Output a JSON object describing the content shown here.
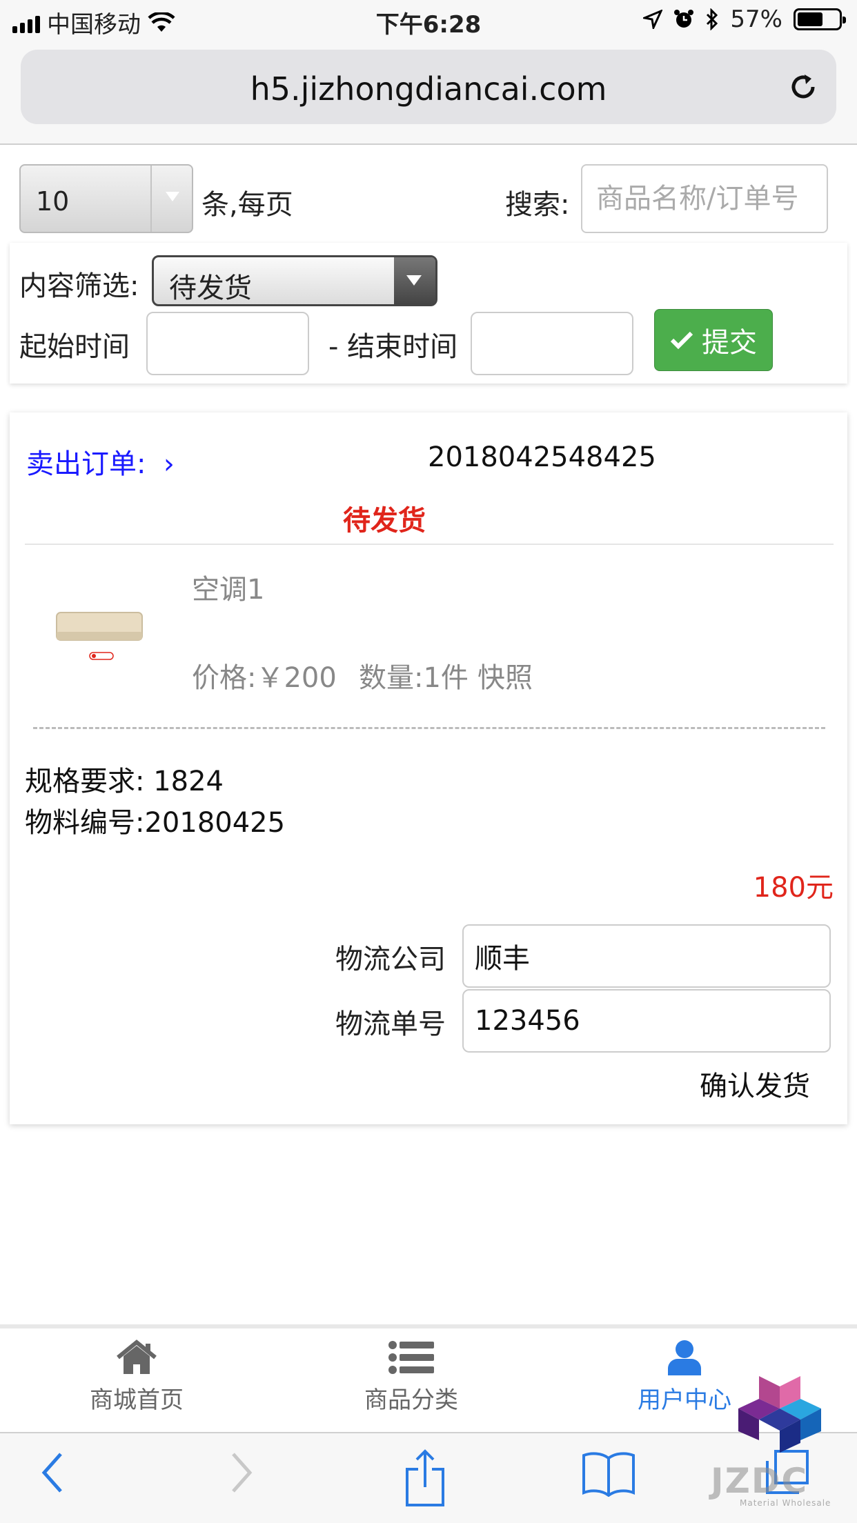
{
  "status_bar": {
    "carrier": "中国移动",
    "time": "下午6:28",
    "battery": "57%"
  },
  "browser": {
    "url": "h5.jizhongdiancai.com"
  },
  "filters": {
    "page_size": "10",
    "page_size_suffix": "条,每页",
    "search_label": "搜索:",
    "search_placeholder": "商品名称/订单号",
    "filter_label": "内容筛选:",
    "filter_value": "待发货",
    "start_label": "起始时间",
    "end_label": "- 结束时间",
    "submit_label": "提交"
  },
  "order": {
    "link_label": "卖出订单:",
    "order_number": "2018042548425",
    "status": "待发货",
    "product_name": "空调1",
    "price": "价格:￥200",
    "quantity": "数量:1件",
    "snapshot": "快照",
    "spec": "规格要求: 1824",
    "material_no": "物料编号:20180425",
    "amount": "180元",
    "logistics_company_label": "物流公司",
    "logistics_company_value": "顺丰",
    "logistics_no_label": "物流单号",
    "logistics_no_value": "123456",
    "confirm_label": "确认发货"
  },
  "tabs": [
    {
      "label": "商城首页",
      "icon": "home-icon"
    },
    {
      "label": "商品分类",
      "icon": "list-icon"
    },
    {
      "label": "用户中心",
      "icon": "user-icon",
      "active": true
    }
  ],
  "watermark": {
    "text": "JZDC",
    "sub": "Material Wholesale"
  },
  "colors": {
    "link": "#1a1aff",
    "status_red": "#e0251b",
    "submit_green": "#4cae4c",
    "tab_active": "#2a7be3",
    "safari_blue": "#2a7be3"
  }
}
